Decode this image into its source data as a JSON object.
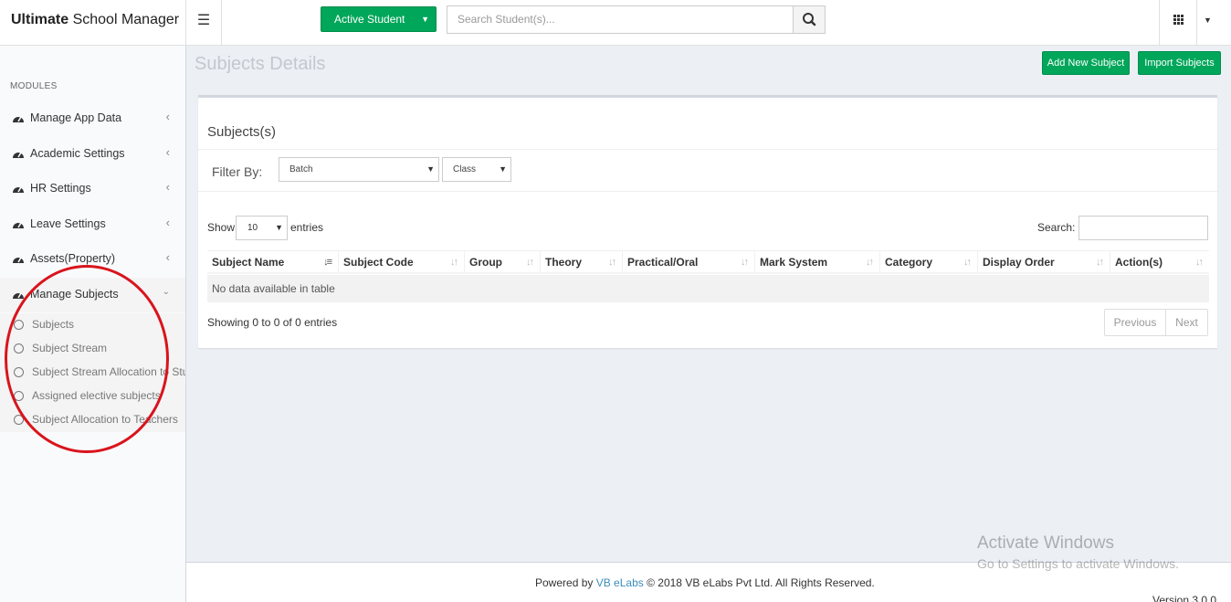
{
  "header": {
    "brand_bold": "Ultimate",
    "brand_rest": "School Manager",
    "status_dropdown": "Active Student",
    "search_placeholder": "Search Student(s)..."
  },
  "sidebar": {
    "section_label": "MODULES",
    "items": [
      {
        "label": "Manage App Data"
      },
      {
        "label": "Academic Settings"
      },
      {
        "label": "HR Settings"
      },
      {
        "label": "Leave Settings"
      },
      {
        "label": "Assets(Property)"
      },
      {
        "label": "Manage Subjects"
      }
    ],
    "sub_items": [
      {
        "label": "Subjects"
      },
      {
        "label": "Subject Stream"
      },
      {
        "label": "Subject Stream Allocation to Students"
      },
      {
        "label": "Assigned elective subjects"
      },
      {
        "label": "Subject Allocation to Teachers"
      }
    ]
  },
  "page": {
    "title": "Subjects Details",
    "add_button": "Add New Subject",
    "import_button": "Import Subjects"
  },
  "box": {
    "title": "Subjects(s)",
    "filter_label": "Filter By:",
    "batch_select": "Batch",
    "class_select": "Class",
    "show_label": "Show",
    "page_length": "10",
    "entries_label": "entries",
    "search_label": "Search:",
    "columns": [
      "Subject Name",
      "Subject Code",
      "Group",
      "Theory",
      "Practical/Oral",
      "Mark System",
      "Category",
      "Display Order",
      "Action(s)"
    ],
    "empty_message": "No data available in table",
    "info": "Showing 0 to 0 of 0 entries",
    "prev": "Previous",
    "next": "Next"
  },
  "footer": {
    "powered_by": "Powered by",
    "company_link": "VB eLabs",
    "copyright": "© 2018 VB eLabs Pvt Ltd. All Rights Reserved.",
    "version": "Version 3.0.0"
  },
  "watermark": {
    "line1": "Activate Windows",
    "line2": "Go to Settings to activate Windows."
  },
  "colors": {
    "accent_green": "#00a65a",
    "link_blue": "#3c8dbc",
    "annotation_red": "#d9141c"
  }
}
